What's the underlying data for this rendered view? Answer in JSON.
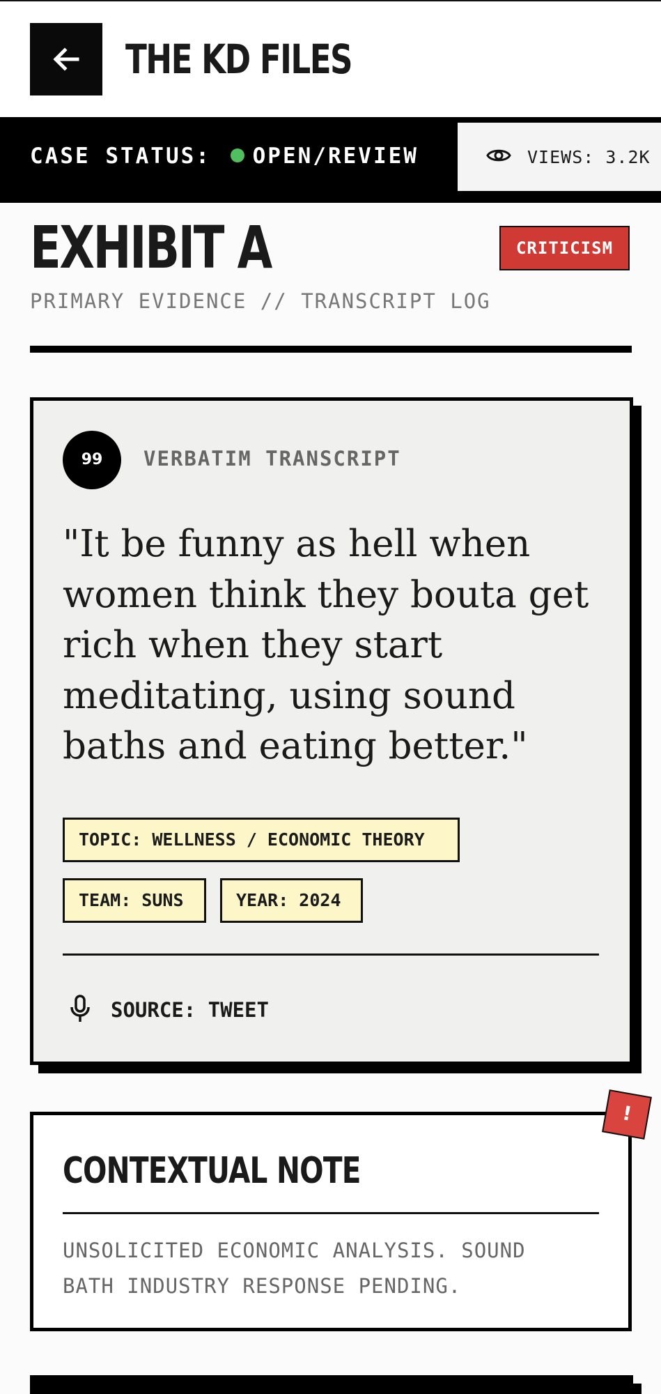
{
  "header": {
    "back_label": "Back",
    "title": "THE KD FILES"
  },
  "status_bar": {
    "case_label": "CASE STATUS:",
    "case_value": "OPEN/REVIEW",
    "status_color": "#4fbf5f",
    "views_label": "VIEWS: 3.2K"
  },
  "exhibit": {
    "title": "EXHIBIT A",
    "badge": "CRITICISM",
    "badge_color": "#d03a35",
    "subtitle": "PRIMARY EVIDENCE // TRANSCRIPT LOG"
  },
  "evidence_card": {
    "badge_number": "99",
    "label": "VERBATIM TRANSCRIPT",
    "quote": "\"It be funny as hell when women think they bouta get rich when they start meditating, using sound baths and eating better.\"",
    "tags": [
      {
        "text": "TOPIC: WELLNESS / ECONOMIC THEORY"
      },
      {
        "text": "TEAM: SUNS"
      },
      {
        "text": "YEAR: 2024"
      }
    ],
    "source_icon": "microphone-icon",
    "source": "SOURCE: TWEET"
  },
  "context_note": {
    "alert_icon": "!",
    "title": "CONTEXTUAL NOTE",
    "body": "UNSOLICITED ECONOMIC ANALYSIS. SOUND BATH INDUSTRY RESPONSE PENDING.",
    "alert_color": "#d9443e"
  },
  "colors": {
    "tag_background": "#fcf6c8",
    "card_background": "#f0f0ef"
  }
}
